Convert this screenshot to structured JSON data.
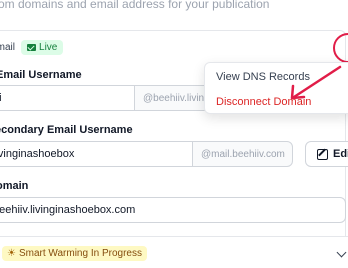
{
  "header": {
    "subtitle": "om domains and email address for your publication"
  },
  "status": {
    "email_label": "Email",
    "live_label": "Live"
  },
  "fields": {
    "email_username": {
      "label": "Email Username",
      "value": "hi",
      "suffix": "@beehiiv.livin"
    },
    "secondary_email": {
      "label": "econdary Email Username",
      "value": "livinginashoebox",
      "suffix": "@mail.beehiiv.com"
    },
    "domain": {
      "label": "omain",
      "value": "beehiiv.livinginashoebox.com"
    }
  },
  "edit_button": {
    "label": "Edi"
  },
  "warming": {
    "label": "Smart Warming In Progress"
  },
  "dropdown": {
    "items": [
      "View DNS Records",
      "Disconnect Domain"
    ]
  },
  "colors": {
    "accent_red": "#e11d48",
    "danger": "#dc2626",
    "live_green": "#15803d",
    "warming_yellow": "#fef9c3"
  }
}
